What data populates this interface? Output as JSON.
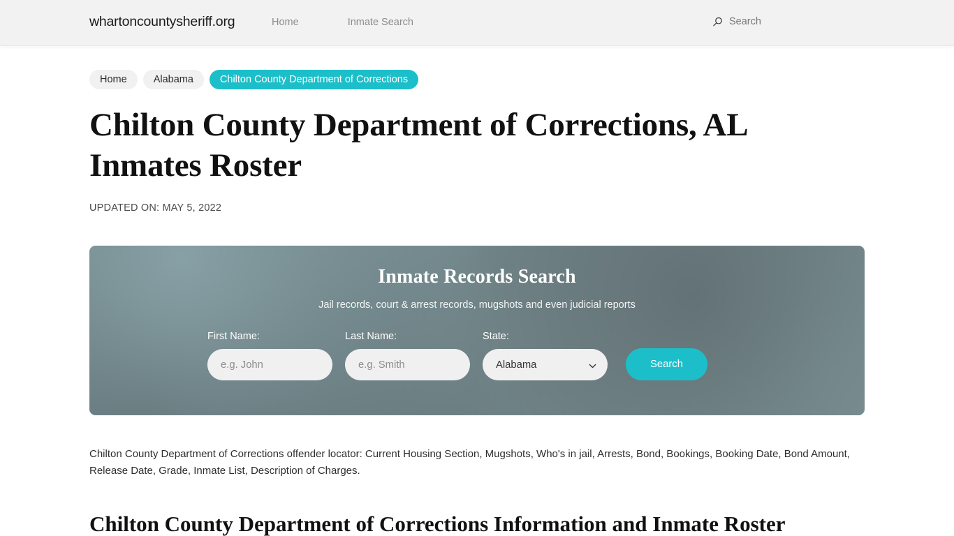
{
  "header": {
    "brand": "whartoncountysheriff.org",
    "nav": [
      {
        "label": "Home"
      },
      {
        "label": "Inmate Search"
      }
    ],
    "search": {
      "icon": "search-icon",
      "label": "Search"
    }
  },
  "breadcrumb": [
    {
      "label": "Home",
      "active": false
    },
    {
      "label": "Alabama",
      "active": false
    },
    {
      "label": "Chilton County Department of Corrections",
      "active": true
    }
  ],
  "main": {
    "title": "Chilton County Department of Corrections, AL Inmates Roster",
    "updated": "UPDATED ON: MAY 5, 2022",
    "paragraph": "Chilton County Department of Corrections offender locator: Current Housing Section, Mugshots, Who's in jail, Arrests, Bond, Bookings, Booking Date, Bond Amount, Release Date, Grade, Inmate List, Description of Charges.",
    "section_title": "Chilton County Department of Corrections Information and Inmate Roster"
  },
  "search_panel": {
    "title": "Inmate Records Search",
    "subtitle": "Jail records, court & arrest records, mugshots and even judicial reports",
    "fields": {
      "first_name": {
        "label": "First Name:",
        "value": "",
        "placeholder": "e.g. John"
      },
      "last_name": {
        "label": "Last Name:",
        "value": "",
        "placeholder": "e.g. Smith"
      },
      "state": {
        "label": "State:",
        "selected": "Alabama",
        "options": [
          "Alabama"
        ],
        "chevron_icon": "chevron-down-icon"
      }
    },
    "submit_label": "Search"
  },
  "colors": {
    "accent_teal": "#1cbfc9",
    "header_bg": "#f2f2f2",
    "crumb_bg": "#f1f1f1",
    "panel_base": "#75888d",
    "input_bg": "#f0f0f0"
  }
}
